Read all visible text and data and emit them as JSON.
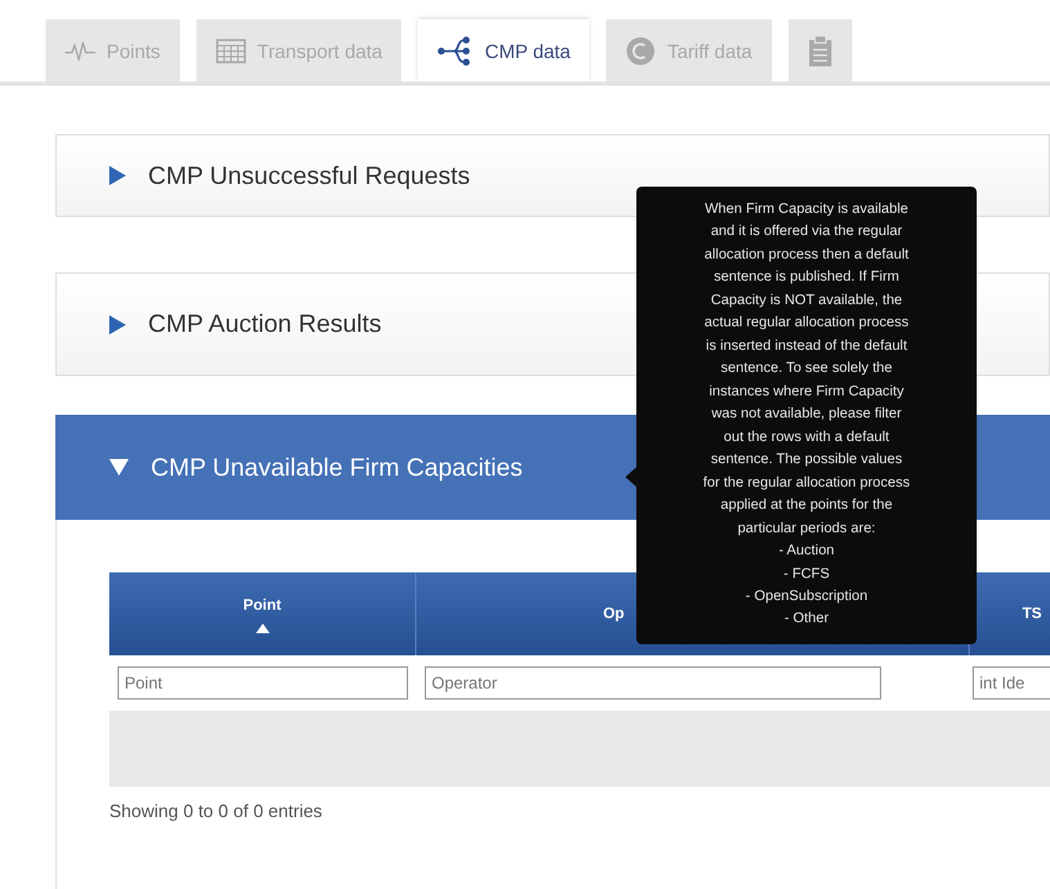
{
  "tabs": [
    {
      "label": "Points",
      "selected": false
    },
    {
      "label": "Transport data",
      "selected": false
    },
    {
      "label": "CMP data",
      "selected": true
    },
    {
      "label": "Tariff data",
      "selected": false
    },
    {
      "selected": false
    }
  ],
  "sections": [
    {
      "title": "CMP Unsuccessful Requests",
      "expanded": false
    },
    {
      "title": "CMP Auction Results",
      "expanded": false
    },
    {
      "title": "CMP Unavailable Firm Capacities",
      "expanded": true
    }
  ],
  "table": {
    "columns": [
      {
        "label": "Point",
        "sorted": true
      },
      {
        "label": "Op",
        "sorted": false
      },
      {
        "label": "TS",
        "sorted": false
      }
    ],
    "filters": [
      {
        "placeholder": "Point"
      },
      {
        "placeholder": "Operator"
      },
      {
        "placeholder": "int Ide"
      }
    ],
    "info": "Showing 0 to 0 of 0 entries"
  },
  "tooltip": {
    "lines": [
      "When Firm Capacity is available",
      "and it is offered via the regular",
      "allocation process then a default",
      "sentence is published. If Firm",
      "Capacity is NOT available, the",
      "actual regular allocation process",
      "is inserted instead of the default",
      "sentence. To see solely the",
      "instances where Firm Capacity",
      "was not available, please filter",
      "out the rows with a default",
      "sentence. The possible values",
      "for the regular allocation process",
      "applied at the points for the",
      "particular periods are:",
      "- Auction",
      "- FCFS",
      "- OpenSubscription",
      "- Other"
    ]
  }
}
